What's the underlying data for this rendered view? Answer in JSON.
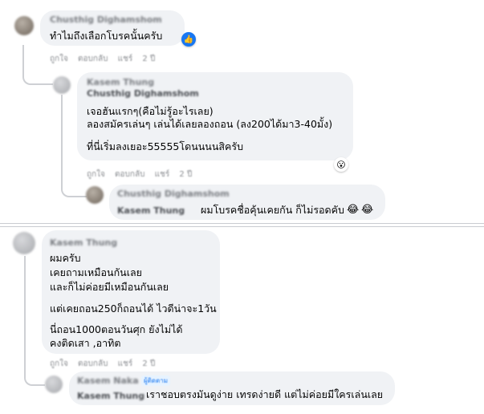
{
  "comments": {
    "c1": {
      "author": "Chusthig Dighamshom",
      "lines": [
        "ทำไมถึงเลือกโบรคนั้นครับ"
      ],
      "meta": [
        "ถูกใจ",
        "ตอบกลับ",
        "แชร์",
        "2 ปี"
      ]
    },
    "c2": {
      "author": "Kasem Thung",
      "mention": "Chusthig Dighamshom",
      "lines": [
        "เจอฮันแรกๆ(คือไม่รู้อะไรเลย)",
        "ลองสมัครเล่นๆ เล่นได้เลยลองถอน (ลง200ได้มา3-40มั้ง)",
        "ที่นี่เริ่มลงเยอะ55555โดนนนนสิครับ"
      ],
      "meta": [
        "ถูกใจ",
        "ตอบกลับ",
        "แชร์",
        "2 ปี"
      ]
    },
    "c3": {
      "author": "Chusthig Dighamshom",
      "mention": "Kasem Thung",
      "text": "ผมโบรคชื่อคุ้นเคยกัน ก็ไม่รอดคับ"
    },
    "c4": {
      "author": "Kasem Thung",
      "lines": [
        "ผมครับ",
        "เคยถามเหมือนกันเลย",
        "และก็ไม่ค่อยมีเหมือนกันเลย",
        "แต่เคยถอน250ก็ถอนได้ ไวดีน่าจะ1วัน",
        "นี่ถอน1000ตอนวันศุก ยังไม่ได้",
        "คงติดเสา ,อาทิต"
      ],
      "meta": [
        "ถูกใจ",
        "ตอบกลับ",
        "แชร์",
        "2 ปี"
      ]
    },
    "c5": {
      "author": "Kasem Naka",
      "badge": "ผู้ติดตาม",
      "mention": "Kasem Thung",
      "text": "เราชอบตรงมันดูง่าย เทรดง่ายดี แต่ไม่ค่อยมีใครเล่นเลย"
    }
  },
  "icons": {
    "like": "like-icon",
    "wow": "wow-emoji-icon",
    "laugh": "laugh-cry-emoji-icon"
  },
  "colors": {
    "bubble": "#f0f2f5",
    "like": "#1877f2"
  }
}
